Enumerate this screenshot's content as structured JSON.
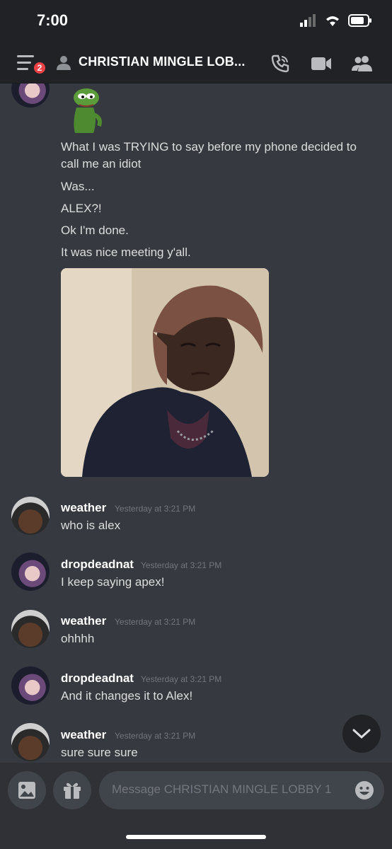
{
  "status_bar": {
    "time": "7:00"
  },
  "header": {
    "badge_count": "2",
    "title": "CHRISTIAN MINGLE LOB...",
    "icons": [
      "hamburger-icon",
      "dm-person-icon",
      "call-icon",
      "video-icon",
      "members-icon"
    ]
  },
  "first_message": {
    "lines": [
      "What I was TRYING to say before my phone decided to",
      "call me an idiot",
      "Was...",
      "ALEX?!",
      "Ok I'm done.",
      "It was nice meeting y'all."
    ]
  },
  "messages": [
    {
      "username": "weather",
      "timestamp": "Yesterday at 3:21 PM",
      "text": "who is alex"
    },
    {
      "username": "dropdeadnat",
      "timestamp": "Yesterday at 3:21 PM",
      "text": "I keep saying apex!"
    },
    {
      "username": "weather",
      "timestamp": "Yesterday at 3:21 PM",
      "text": "ohhhh"
    },
    {
      "username": "dropdeadnat",
      "timestamp": "Yesterday at 3:21 PM",
      "text": "And it changes it to Alex!"
    },
    {
      "username": "weather",
      "timestamp": "Yesterday at 3:21 PM",
      "text": "sure sure sure"
    }
  ],
  "input": {
    "placeholder": "Message CHRISTIAN MINGLE LOBBY 1"
  },
  "colors": {
    "background": "#36393f",
    "header": "#202225",
    "badge": "#ed4245",
    "input": "#40444b"
  }
}
